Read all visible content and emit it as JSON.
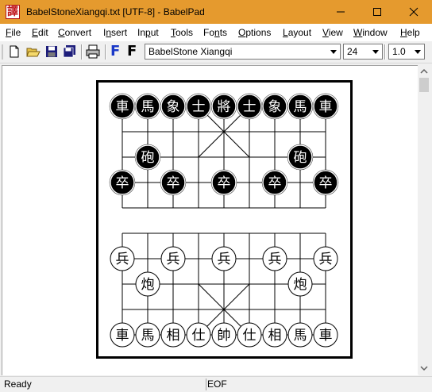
{
  "window": {
    "title": "BabelStoneXiangqi.txt [UTF-8] - BabelPad",
    "app_icon_glyph": "譯"
  },
  "menu": [
    {
      "label": "File",
      "accel": "F",
      "rest": "ile"
    },
    {
      "label": "Edit",
      "accel": "E",
      "rest": "dit"
    },
    {
      "label": "Convert",
      "accel": "C",
      "rest": "onvert"
    },
    {
      "label": "Insert",
      "accel": "I",
      "rest": "nsert",
      "pre": ""
    },
    {
      "label": "Input",
      "accel": "",
      "rest": "Input"
    },
    {
      "label": "Tools",
      "accel": "T",
      "rest": "ools"
    },
    {
      "label": "Fonts",
      "accel": "",
      "rest": "Fonts"
    },
    {
      "label": "Options",
      "accel": "O",
      "rest": "ptions"
    },
    {
      "label": "Layout",
      "accel": "L",
      "rest": "ayout"
    },
    {
      "label": "View",
      "accel": "V",
      "rest": "iew"
    },
    {
      "label": "Window",
      "accel": "W",
      "rest": "indow"
    },
    {
      "label": "Help",
      "accel": "H",
      "rest": "elp"
    }
  ],
  "toolbar": {
    "font_name": "BabelStone Xiangqi",
    "font_size": "24",
    "line_spacing": "1.0",
    "font_blue_glyph": "F",
    "font_black_glyph": "F"
  },
  "status": {
    "left": "Ready",
    "right": "EOF"
  },
  "colors": {
    "titlebar": "#e59a2e",
    "piece_black": "#000000",
    "piece_red_outline": "#000000"
  },
  "board": {
    "black_back_row": [
      "車",
      "馬",
      "象",
      "士",
      "將",
      "士",
      "象",
      "馬",
      "車"
    ],
    "black_cannons": [
      {
        "file": 1,
        "glyph": "砲"
      },
      {
        "file": 7,
        "glyph": "砲"
      }
    ],
    "black_soldiers": [
      {
        "file": 0,
        "glyph": "卒"
      },
      {
        "file": 2,
        "glyph": "卒"
      },
      {
        "file": 4,
        "glyph": "卒"
      },
      {
        "file": 6,
        "glyph": "卒"
      },
      {
        "file": 8,
        "glyph": "卒"
      }
    ],
    "red_soldiers": [
      {
        "file": 0,
        "glyph": "兵"
      },
      {
        "file": 2,
        "glyph": "兵"
      },
      {
        "file": 4,
        "glyph": "兵"
      },
      {
        "file": 6,
        "glyph": "兵"
      },
      {
        "file": 8,
        "glyph": "兵"
      }
    ],
    "red_cannons": [
      {
        "file": 1,
        "glyph": "炮"
      },
      {
        "file": 7,
        "glyph": "炮"
      }
    ],
    "red_back_row": [
      "車",
      "馬",
      "相",
      "仕",
      "帥",
      "仕",
      "相",
      "馬",
      "車"
    ]
  }
}
